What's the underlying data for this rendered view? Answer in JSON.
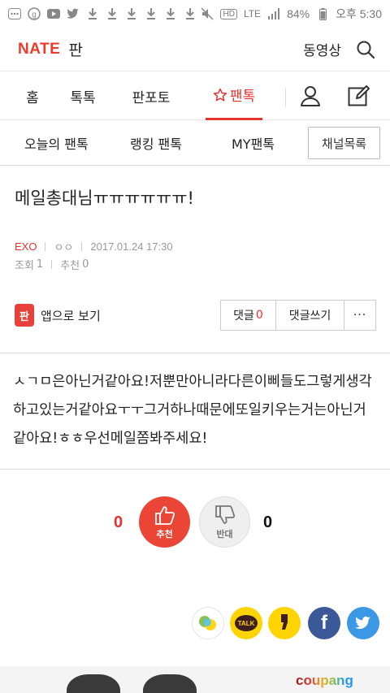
{
  "status_bar": {
    "left_icons": [
      "more-icon",
      "g-icon",
      "youtube-icon",
      "twitter-icon",
      "download-icon",
      "download-icon",
      "download-icon",
      "download-icon",
      "download-icon",
      "download-icon"
    ],
    "right_icons": [
      "mute-icon",
      "hd-icon",
      "lte-icon",
      "signal-icon",
      "battery-icon"
    ],
    "hd": "HD",
    "lte": "LTE",
    "battery": "84%",
    "time": "오후 5:30"
  },
  "header": {
    "logo": "NATE",
    "section": "판",
    "video_label": "동영상"
  },
  "main_nav": {
    "items": [
      {
        "label": "홈"
      },
      {
        "label": "톡톡"
      },
      {
        "label": "판포토"
      },
      {
        "label": "팬톡",
        "active": true
      }
    ]
  },
  "sub_nav": {
    "items": [
      {
        "label": "오늘의 팬톡"
      },
      {
        "label": "랭킹 팬톡"
      },
      {
        "label": "MY팬톡"
      }
    ],
    "channel_list": "채널목록"
  },
  "article": {
    "title": "메일총대님ㅠㅠㅠㅠㅠㅠ!",
    "category": "EXO",
    "author": "ㅇㅇ",
    "datetime": "2017.01.24 17:30",
    "views_label": "조회",
    "views": "1",
    "recommend_label": "추천",
    "recommend": "0",
    "app_view": "앱으로 보기",
    "app_icon_text": "판",
    "body": "ㅅㄱㅁ은아닌거같아요!저뿐만아니라다른이삐들도그렇게생각하고있는거같아요ㅜㅜ그거하나때문에또일키우는거는아닌거같아요!ㅎㅎ우선메일쫌봐주세요!"
  },
  "comments": {
    "label": "댓글",
    "count": "0",
    "write": "댓글쓰기",
    "more": "···"
  },
  "votes": {
    "up_count": "0",
    "up_label": "추천",
    "down_count": "0",
    "down_label": "반대"
  },
  "share": {
    "items": [
      "nate-icon",
      "kakaotalk-icon",
      "kakaostory-icon",
      "facebook-icon",
      "twitter-icon"
    ],
    "talk": "TALK",
    "facebook_glyph": "f"
  },
  "ad": {
    "brand": "coupang"
  },
  "colors": {
    "accent": "#e8322d",
    "facebook": "#3b5998",
    "twitter": "#3a98e5",
    "kakao": "#ffd400"
  }
}
